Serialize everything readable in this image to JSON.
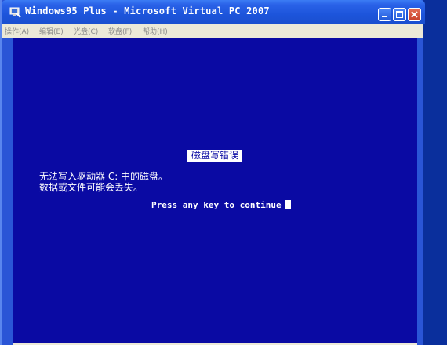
{
  "window": {
    "title": "Windows95 Plus - Microsoft Virtual PC 2007"
  },
  "menubar": {
    "items": [
      {
        "label": "操作(A)"
      },
      {
        "label": "编辑(E)"
      },
      {
        "label": "光盘(C)"
      },
      {
        "label": "软盘(F)"
      },
      {
        "label": "帮助(H)"
      }
    ]
  },
  "screen": {
    "error_title": "磁盘写错误",
    "lines": [
      "无法写入驱动器 C: 中的磁盘。",
      "数据或文件可能会丢失。"
    ],
    "prompt": "Press any key to continue"
  },
  "colors": {
    "bsod_background": "#0a0aa3",
    "text": "#ffffff",
    "titlebar": "#1d55dc",
    "menubar": "#ece9d8"
  },
  "icons": {
    "app": "virtual-pc-icon",
    "minimize": "minimize-icon",
    "maximize": "maximize-icon",
    "close": "close-icon"
  }
}
